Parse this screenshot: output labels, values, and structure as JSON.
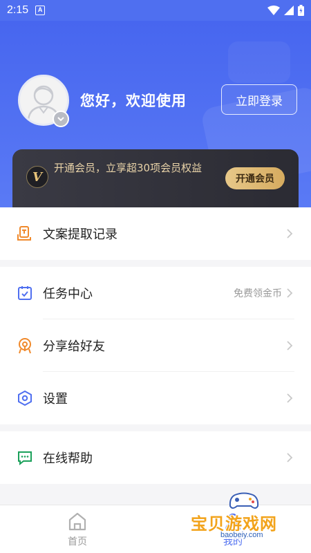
{
  "status_bar": {
    "time": "2:15",
    "a_badge": "A"
  },
  "header": {
    "greeting": "您好，欢迎使用",
    "login_label": "立即登录"
  },
  "vip": {
    "logo_letter": "V",
    "text": "开通会员，立享超30项会员权益",
    "button_label": "开通会员"
  },
  "menu": {
    "records": {
      "label": "文案提取记录"
    },
    "tasks": {
      "label": "任务中心",
      "hint": "免费领金币"
    },
    "share": {
      "label": "分享给好友"
    },
    "settings": {
      "label": "设置"
    },
    "help": {
      "label": "在线帮助"
    }
  },
  "tabbar": {
    "home_label": "首页",
    "mine_label": "我的"
  },
  "watermark": {
    "title": "宝贝游戏网",
    "url": "baobeiy.com"
  },
  "colors": {
    "header": "#4766ef",
    "vip_gold": "#e9d3a8",
    "icon_orange": "#f0892b",
    "icon_blue": "#4f6ff0",
    "icon_green": "#1aa05a",
    "accent_tab": "#4f6ff0"
  },
  "icons": [
    "wifi-icon",
    "signal-icon",
    "battery-icon",
    "avatar-icon",
    "chevron-down-icon",
    "document-icon",
    "calendar-check-icon",
    "share-icon",
    "settings-icon",
    "chat-icon",
    "chevron-right-icon",
    "home-icon"
  ]
}
